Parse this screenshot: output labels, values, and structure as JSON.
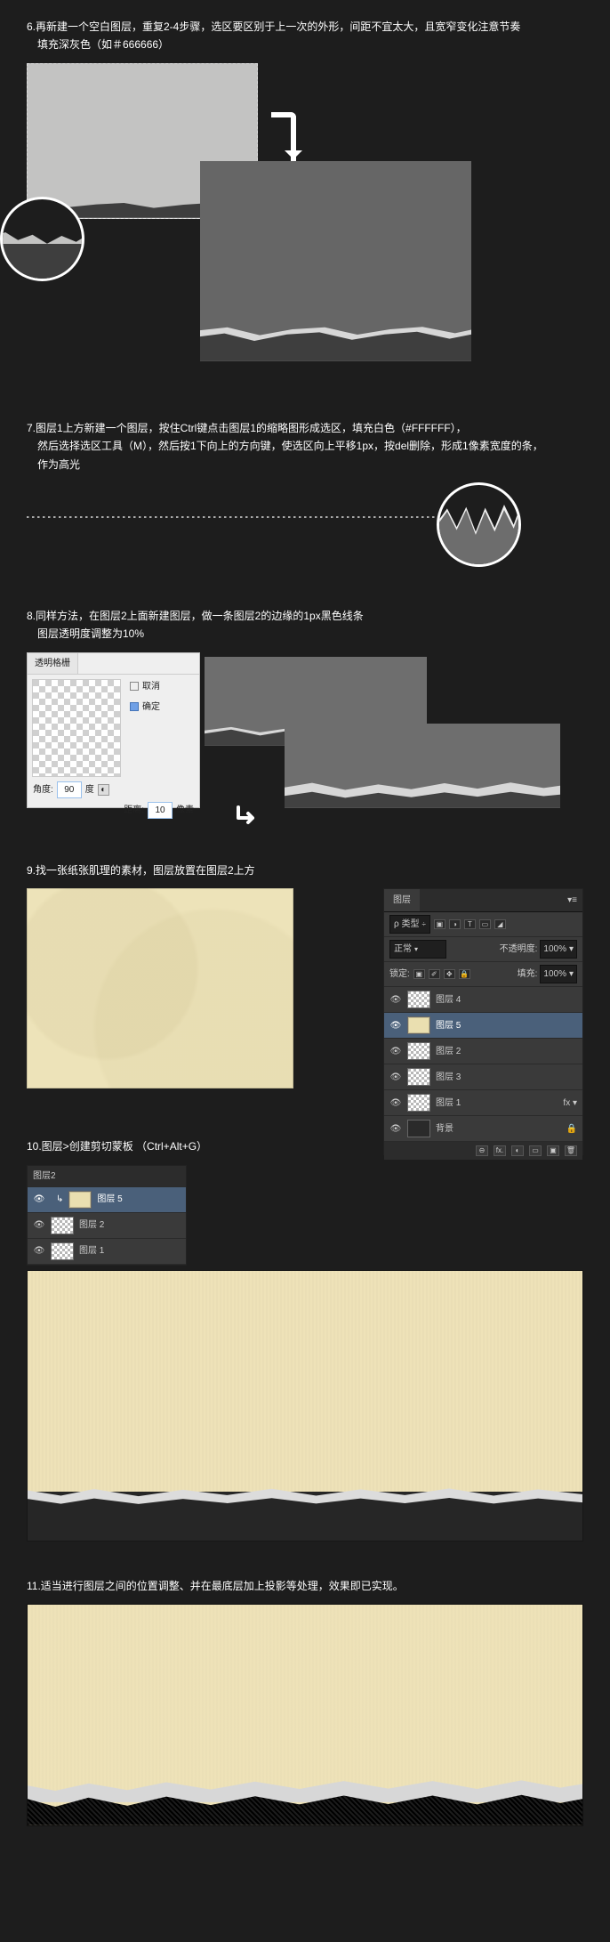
{
  "step6": {
    "text_line1": "6.再新建一个空白图层，重复2-4步骤，选区要区别于上一次的外形，间距不宜太大，且宽窄变化注意节奏",
    "text_line2": "填充深灰色（如＃666666）"
  },
  "step7": {
    "text_line1": "7.图层1上方新建一个图层，按住Ctrl键点击图层1的缩略图形成选区，填充白色（#FFFFFF），",
    "text_line2": "然后选择选区工具（M），然后按1下向上的方向键，使选区向上平移1px，按del删除，形成1像素宽度的条，",
    "text_line3": "作为高光"
  },
  "step8": {
    "text_line1": "8.同样方法，在图层2上面新建图层，做一条图层2的边缘的1px黑色线条",
    "text_line2": "图层透明度调整为10%",
    "panel_tab": "透明格栅",
    "radio1": "取消",
    "radio2": "确定",
    "angle_label": "角度:",
    "angle_value": "90",
    "angle_unit": "度",
    "dist_label": "距离:",
    "dist_value": "10",
    "dist_unit": "像素"
  },
  "step9": {
    "text": "9.找一张纸张肌理的素材，图层放置在图层2上方"
  },
  "layers": {
    "tab": "图层",
    "menu_glyph": "▾≡",
    "kind_label": "ρ 类型",
    "kind_dd": "÷",
    "filter_icons": [
      "▣",
      "◑",
      "T",
      "▭",
      "◢"
    ],
    "mode": "正常",
    "opacity_label": "不透明度:",
    "opacity_value": "100%",
    "lock_label": "锁定:",
    "lock_icons": [
      "▣",
      "✐",
      "✥",
      "🔒"
    ],
    "fill_label": "填充:",
    "fill_value": "100%",
    "items": [
      {
        "name": "图层 4",
        "thumb": "checker"
      },
      {
        "name": "图层 5",
        "thumb": "paper",
        "selected": true
      },
      {
        "name": "图层 2",
        "thumb": "checker"
      },
      {
        "name": "图层 3",
        "thumb": "checker"
      },
      {
        "name": "图层 1",
        "thumb": "checker",
        "fx": "fx"
      },
      {
        "name": "背景",
        "thumb": "dark",
        "lock": "🔒"
      }
    ],
    "foot_icons": [
      "⊖",
      "fx.",
      "◐",
      "▭",
      "▣",
      "🗑"
    ]
  },
  "step10": {
    "text": "10.图层>创建剪切蒙板 （Ctrl+Alt+G）",
    "mini_top": "图层2",
    "mini_items": [
      {
        "name": "图层 5",
        "thumb": "paper",
        "selected": true,
        "indent": true,
        "arrow": "↳"
      },
      {
        "name": "图层 2",
        "thumb": "checker"
      },
      {
        "name": "图层 1",
        "thumb": "checker"
      }
    ]
  },
  "step11": {
    "text": "11.适当进行图层之间的位置调整、并在最底层加上投影等处理，效果即已实现。"
  },
  "eye_glyph": "👁"
}
